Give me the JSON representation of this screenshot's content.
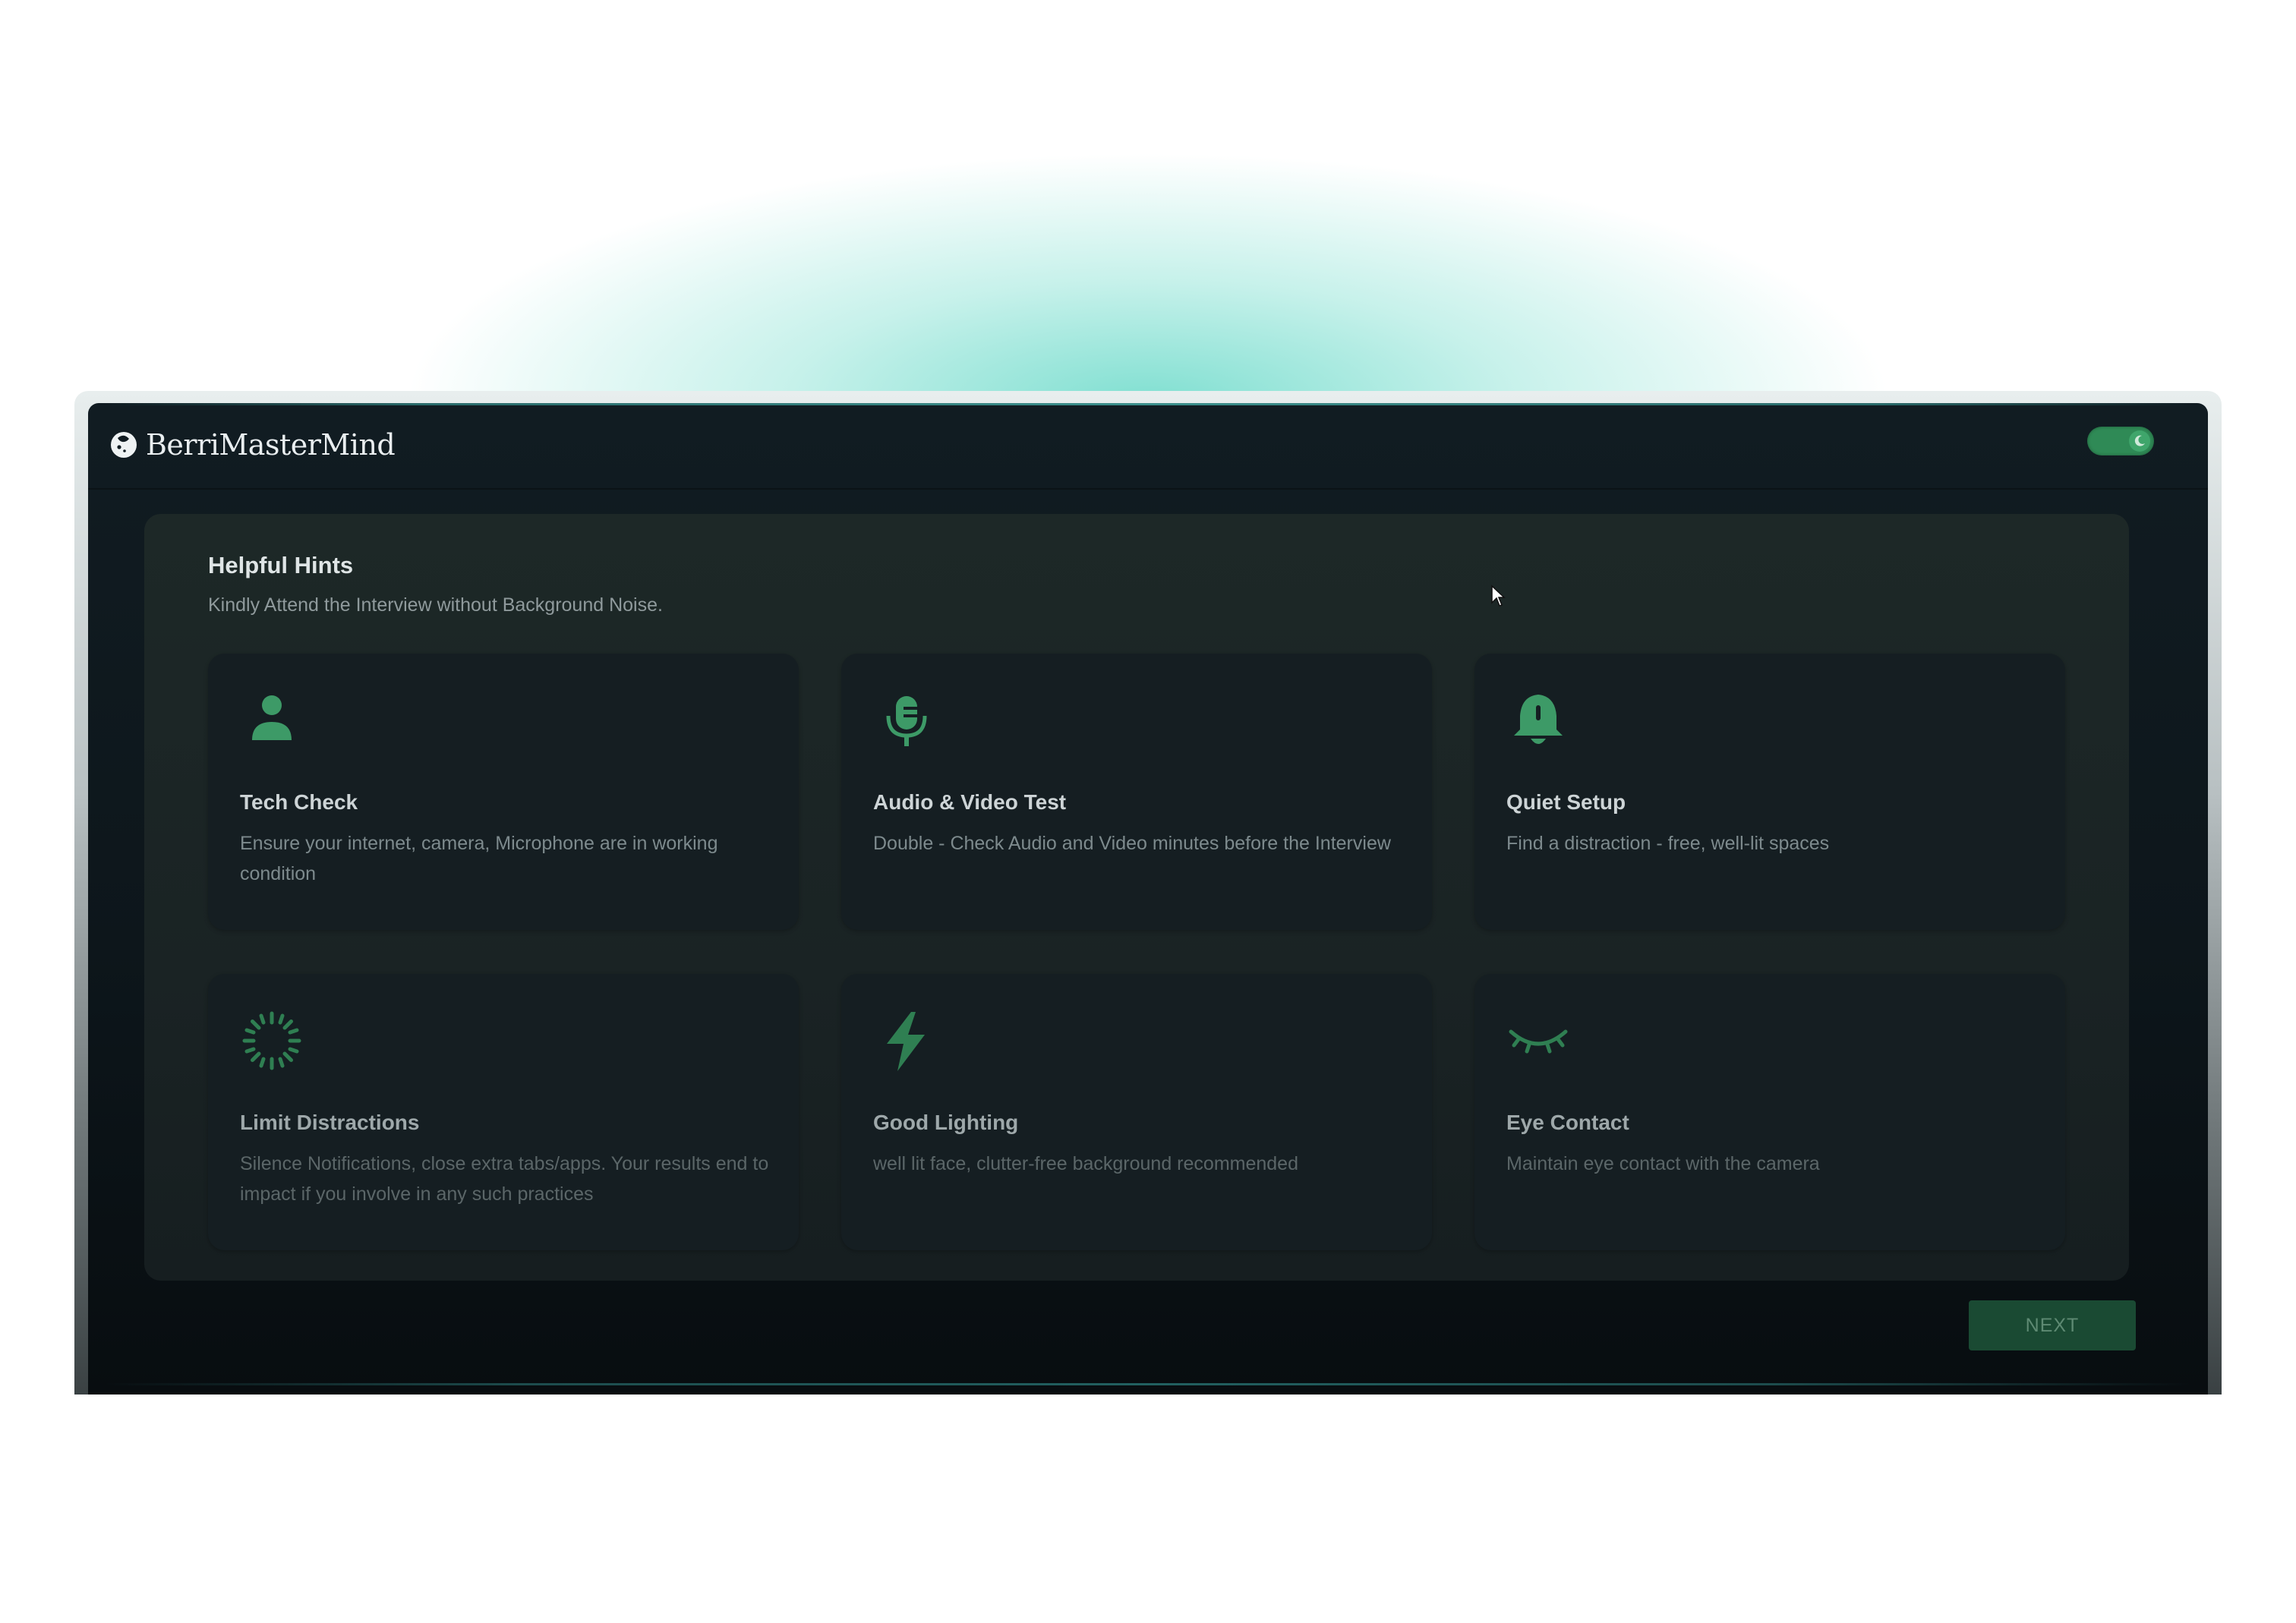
{
  "app": {
    "brand": "BerriMasterMind",
    "theme_toggle_icon": "moon-icon",
    "accent_color": "#2f8a56",
    "icon_color": "#3d9a67"
  },
  "hints": {
    "title": "Helpful Hints",
    "subtitle": "Kindly Attend the Interview without Background Noise.",
    "cards": [
      {
        "icon": "user-icon",
        "title": "Tech Check",
        "description": "Ensure your internet, camera, Microphone are in working condition"
      },
      {
        "icon": "microphone-icon",
        "title": "Audio & Video Test",
        "description": "Double - Check Audio and Video minutes before the Interview"
      },
      {
        "icon": "bell-icon",
        "title": "Quiet Setup",
        "description": "Find a distraction - free, well-lit spaces"
      },
      {
        "icon": "loading-spinner-icon",
        "title": "Limit Distractions",
        "description": "Silence Notifications, close extra tabs/apps. Your results end to impact if you involve in any such practices"
      },
      {
        "icon": "lightning-icon",
        "title": "Good Lighting",
        "description": "well lit face, clutter-free background recommended"
      },
      {
        "icon": "eye-closed-icon",
        "title": "Eye Contact",
        "description": "Maintain eye contact with the camera"
      }
    ]
  },
  "actions": {
    "next_label": "NEXT"
  }
}
